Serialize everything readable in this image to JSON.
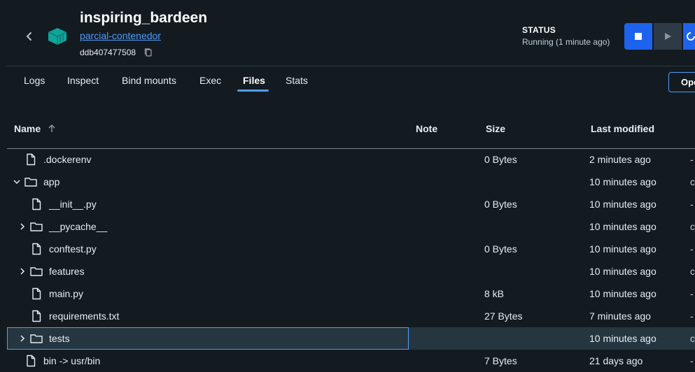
{
  "header": {
    "container_name": "inspiring_bardeen",
    "image_name": "parcial-contenedor",
    "container_id": "ddb407477508",
    "status_label": "STATUS",
    "status_value": "Running (1 minute ago)"
  },
  "tabs": [
    {
      "label": "Logs"
    },
    {
      "label": "Inspect"
    },
    {
      "label": "Bind mounts"
    },
    {
      "label": "Exec"
    },
    {
      "label": "Files"
    },
    {
      "label": "Stats"
    }
  ],
  "active_tab": "Files",
  "open_button_label": "Ope",
  "table": {
    "columns": {
      "name": "Name",
      "note": "Note",
      "size": "Size",
      "modified": "Last modified"
    },
    "rows": [
      {
        "name": ".dockerenv",
        "type": "file",
        "size": "0 Bytes",
        "modified": "2 minutes ago",
        "trail": "-"
      },
      {
        "name": "app",
        "type": "folder-open",
        "size": "",
        "modified": "10 minutes ago",
        "trail": "c"
      },
      {
        "name": "__init__.py",
        "type": "file",
        "size": "0 Bytes",
        "modified": "10 minutes ago",
        "trail": "-"
      },
      {
        "name": "__pycache__",
        "type": "folder",
        "size": "",
        "modified": "10 minutes ago",
        "trail": "c"
      },
      {
        "name": "conftest.py",
        "type": "file",
        "size": "0 Bytes",
        "modified": "10 minutes ago",
        "trail": "-"
      },
      {
        "name": "features",
        "type": "folder",
        "size": "",
        "modified": "10 minutes ago",
        "trail": "c"
      },
      {
        "name": "main.py",
        "type": "file",
        "size": "8 kB",
        "modified": "10 minutes ago",
        "trail": "-"
      },
      {
        "name": "requirements.txt",
        "type": "file",
        "size": "27 Bytes",
        "modified": "7 minutes ago",
        "trail": "-"
      },
      {
        "name": "tests",
        "type": "folder",
        "size": "",
        "modified": "10 minutes ago",
        "trail": "c"
      },
      {
        "name": "bin -> usr/bin",
        "type": "file",
        "size": "7 Bytes",
        "modified": "21 days ago",
        "trail": "-"
      }
    ]
  },
  "colors": {
    "accent": "#1d63ed",
    "link": "#4f9cf9",
    "background": "#131b21",
    "selected_row": "#263641"
  }
}
